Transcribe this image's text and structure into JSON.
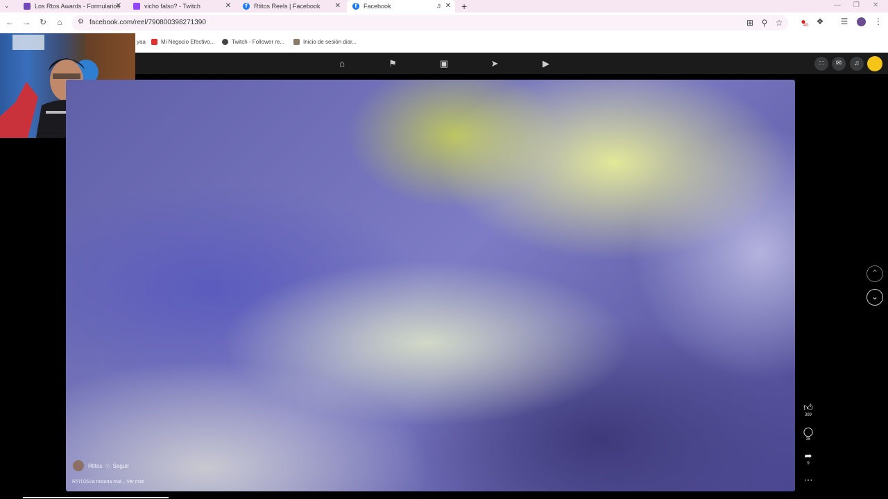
{
  "browser": {
    "tabs": [
      {
        "title": "Los Rtos Awards - Formularios"
      },
      {
        "title": "vicho falso? - Twitch"
      },
      {
        "title": "Rtitos Reels | Facebook"
      },
      {
        "title": "Facebook"
      }
    ],
    "url": "facebook.com/reel/790800398271390",
    "extension_badge": "40",
    "bookmarks": [
      {
        "label": "yaa"
      },
      {
        "label": "Mi Negocio Efectivo..."
      },
      {
        "label": "Twitch - Follower re..."
      },
      {
        "label": "Inicio de sesión diar..."
      }
    ]
  },
  "reel": {
    "author": "Rtitos",
    "follow_label": "Seguir",
    "caption": "RTITOS:la historia mal... Ver más",
    "likes": "389",
    "comments": "36",
    "shares": "9"
  },
  "colors": {
    "tabbar_bg": "#f7e7f2",
    "fb_nav_bg": "#1b1b1b",
    "facebook_blue": "#1877f2"
  },
  "icons": [
    "home-icon",
    "flag-icon",
    "marketplace-icon",
    "megaphone-icon",
    "video-icon",
    "menu-grid-icon",
    "messenger-icon",
    "bell-icon",
    "like-icon",
    "comment-icon",
    "share-icon",
    "more-icon",
    "chevron-up-icon",
    "chevron-down-icon"
  ]
}
